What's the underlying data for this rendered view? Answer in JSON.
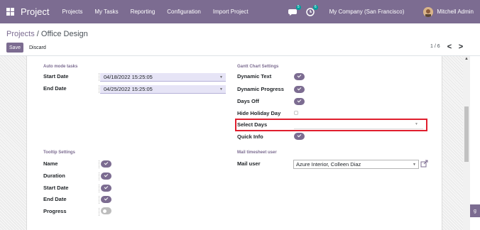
{
  "navbar": {
    "brand": "Project",
    "menu": [
      "Projects",
      "My Tasks",
      "Reporting",
      "Configuration",
      "Import Project"
    ],
    "chat_badge": "5",
    "activity_badge": "6",
    "company": "My Company (San Francisco)",
    "user": "Mitchell Admin"
  },
  "breadcrumb": {
    "parent": "Projects",
    "separator": " / ",
    "current": "Office Design"
  },
  "buttons": {
    "save": "Save",
    "discard": "Discard"
  },
  "pager": {
    "value": "1 / 6",
    "prev": "<",
    "next": ">"
  },
  "auto_mode": {
    "title": "Auto mode tasks",
    "start_label": "Start Date",
    "start_value": "04/18/2022 15:25:05",
    "end_label": "End Date",
    "end_value": "04/25/2022 15:25:05"
  },
  "gantt": {
    "title": "Gantt Chart Settings",
    "dynamic_text": "Dynamic Text",
    "dynamic_progress": "Dynamic Progress",
    "days_off": "Days Off",
    "hide_holiday": "Hide Holiday Day",
    "select_days": "Select Days",
    "quick_info": "Quick Info",
    "states": {
      "dynamic_text": true,
      "dynamic_progress": true,
      "days_off": true,
      "hide_holiday": false,
      "quick_info": true
    }
  },
  "tooltip": {
    "title": "Tooltip Settings",
    "name": "Name",
    "duration": "Duration",
    "start_date": "Start Date",
    "end_date": "End Date",
    "progress": "Progress",
    "states": {
      "name": true,
      "duration": true,
      "start_date": true,
      "end_date": true,
      "progress": false
    }
  },
  "mail": {
    "title": "Mail timesheet user",
    "label": "Mail user",
    "value": "Azure Interior, Colleen Diaz"
  },
  "side_tab": "g",
  "colors": {
    "primary": "#7c6c91",
    "highlight": "#e01e2e",
    "badge": "#00a09d"
  }
}
